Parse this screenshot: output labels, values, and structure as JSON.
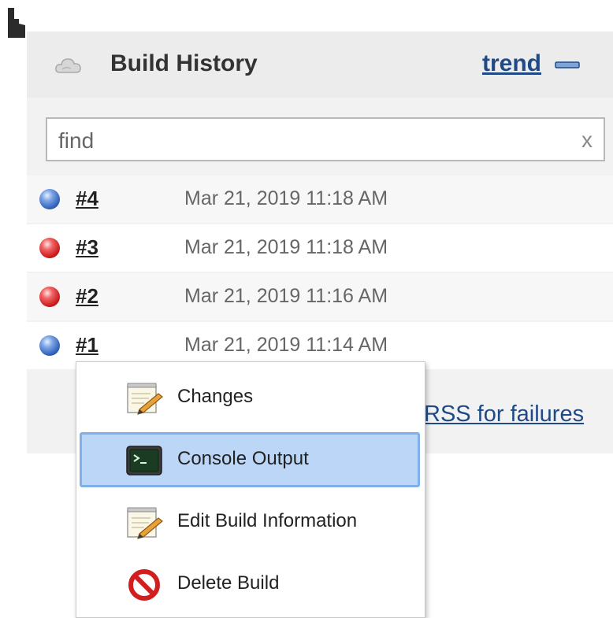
{
  "icons": {
    "cursor": "cursor-hand-icon",
    "widget": "cloud-icon",
    "collapse": "minus-icon",
    "clear": "x-icon",
    "changes": "notepad-pencil-icon",
    "console": "terminal-icon",
    "edit": "notepad-pencil-icon",
    "delete": "prohibited-icon"
  },
  "colors": {
    "link": "#204a87",
    "highlight": "#bcd6f7",
    "highlight_border": "#7fb0ea",
    "status_success": "#2f5fb8",
    "status_failed": "#c81a1a"
  },
  "build_history": {
    "title": "Build History",
    "trend_label": "trend",
    "search": {
      "placeholder": "find",
      "clear_label": "x"
    },
    "builds": [
      {
        "number": "#4",
        "date": "Mar 21, 2019 11:18 AM",
        "status": "success"
      },
      {
        "number": "#3",
        "date": "Mar 21, 2019 11:18 AM",
        "status": "failed"
      },
      {
        "number": "#2",
        "date": "Mar 21, 2019 11:16 AM",
        "status": "failed"
      },
      {
        "number": "#1",
        "date": "Mar 21, 2019 11:14 AM",
        "status": "success"
      }
    ],
    "rss_label": "RSS for failures"
  },
  "context_menu": {
    "items": [
      {
        "label": "Changes",
        "highlighted": false
      },
      {
        "label": "Console Output",
        "highlighted": true
      },
      {
        "label": "Edit Build Information",
        "highlighted": false
      },
      {
        "label": "Delete Build",
        "highlighted": false
      }
    ]
  }
}
